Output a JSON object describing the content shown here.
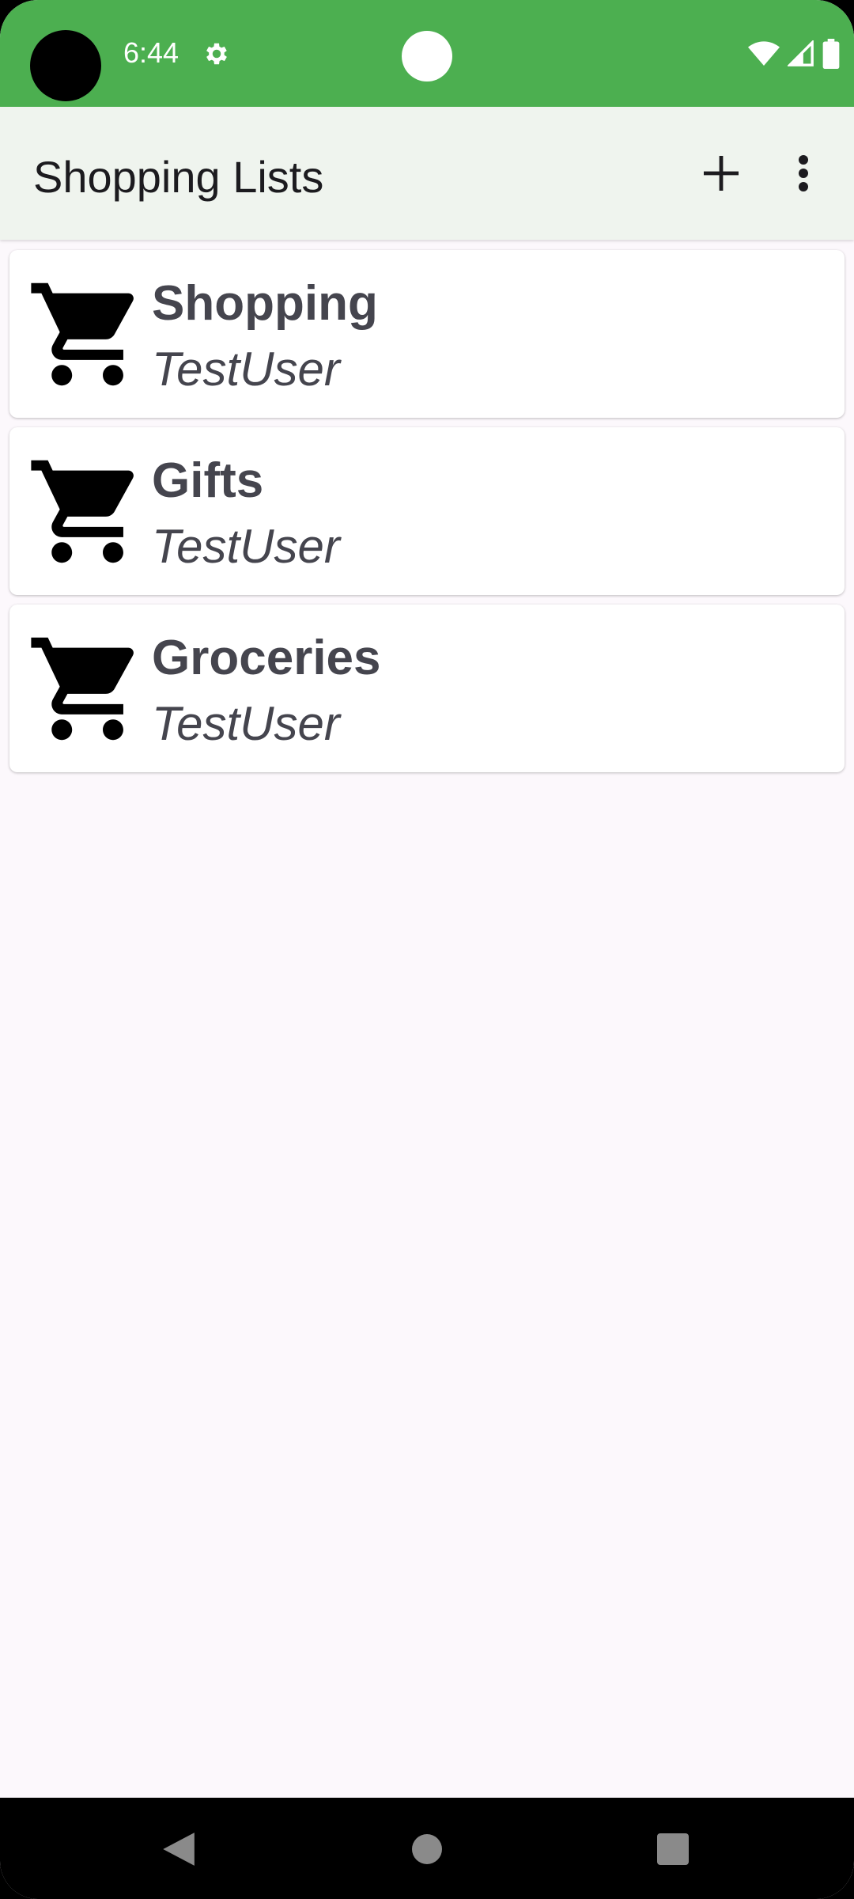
{
  "status_bar": {
    "time": "6:44",
    "icons": [
      "settings-icon",
      "wifi-icon",
      "signal-icon",
      "battery-icon"
    ],
    "color": "#4caf50"
  },
  "app_bar": {
    "title": "Shopping Lists",
    "actions": [
      "add-icon",
      "more-vert-icon"
    ],
    "background": "#eff4ee"
  },
  "lists": [
    {
      "title": "Shopping",
      "owner": "TestUser",
      "icon": "shopping-cart-icon"
    },
    {
      "title": "Gifts",
      "owner": "TestUser",
      "icon": "shopping-cart-icon"
    },
    {
      "title": "Groceries",
      "owner": "TestUser",
      "icon": "shopping-cart-icon"
    }
  ],
  "nav_bar": {
    "buttons": [
      "back-icon",
      "home-icon",
      "recents-icon"
    ]
  }
}
